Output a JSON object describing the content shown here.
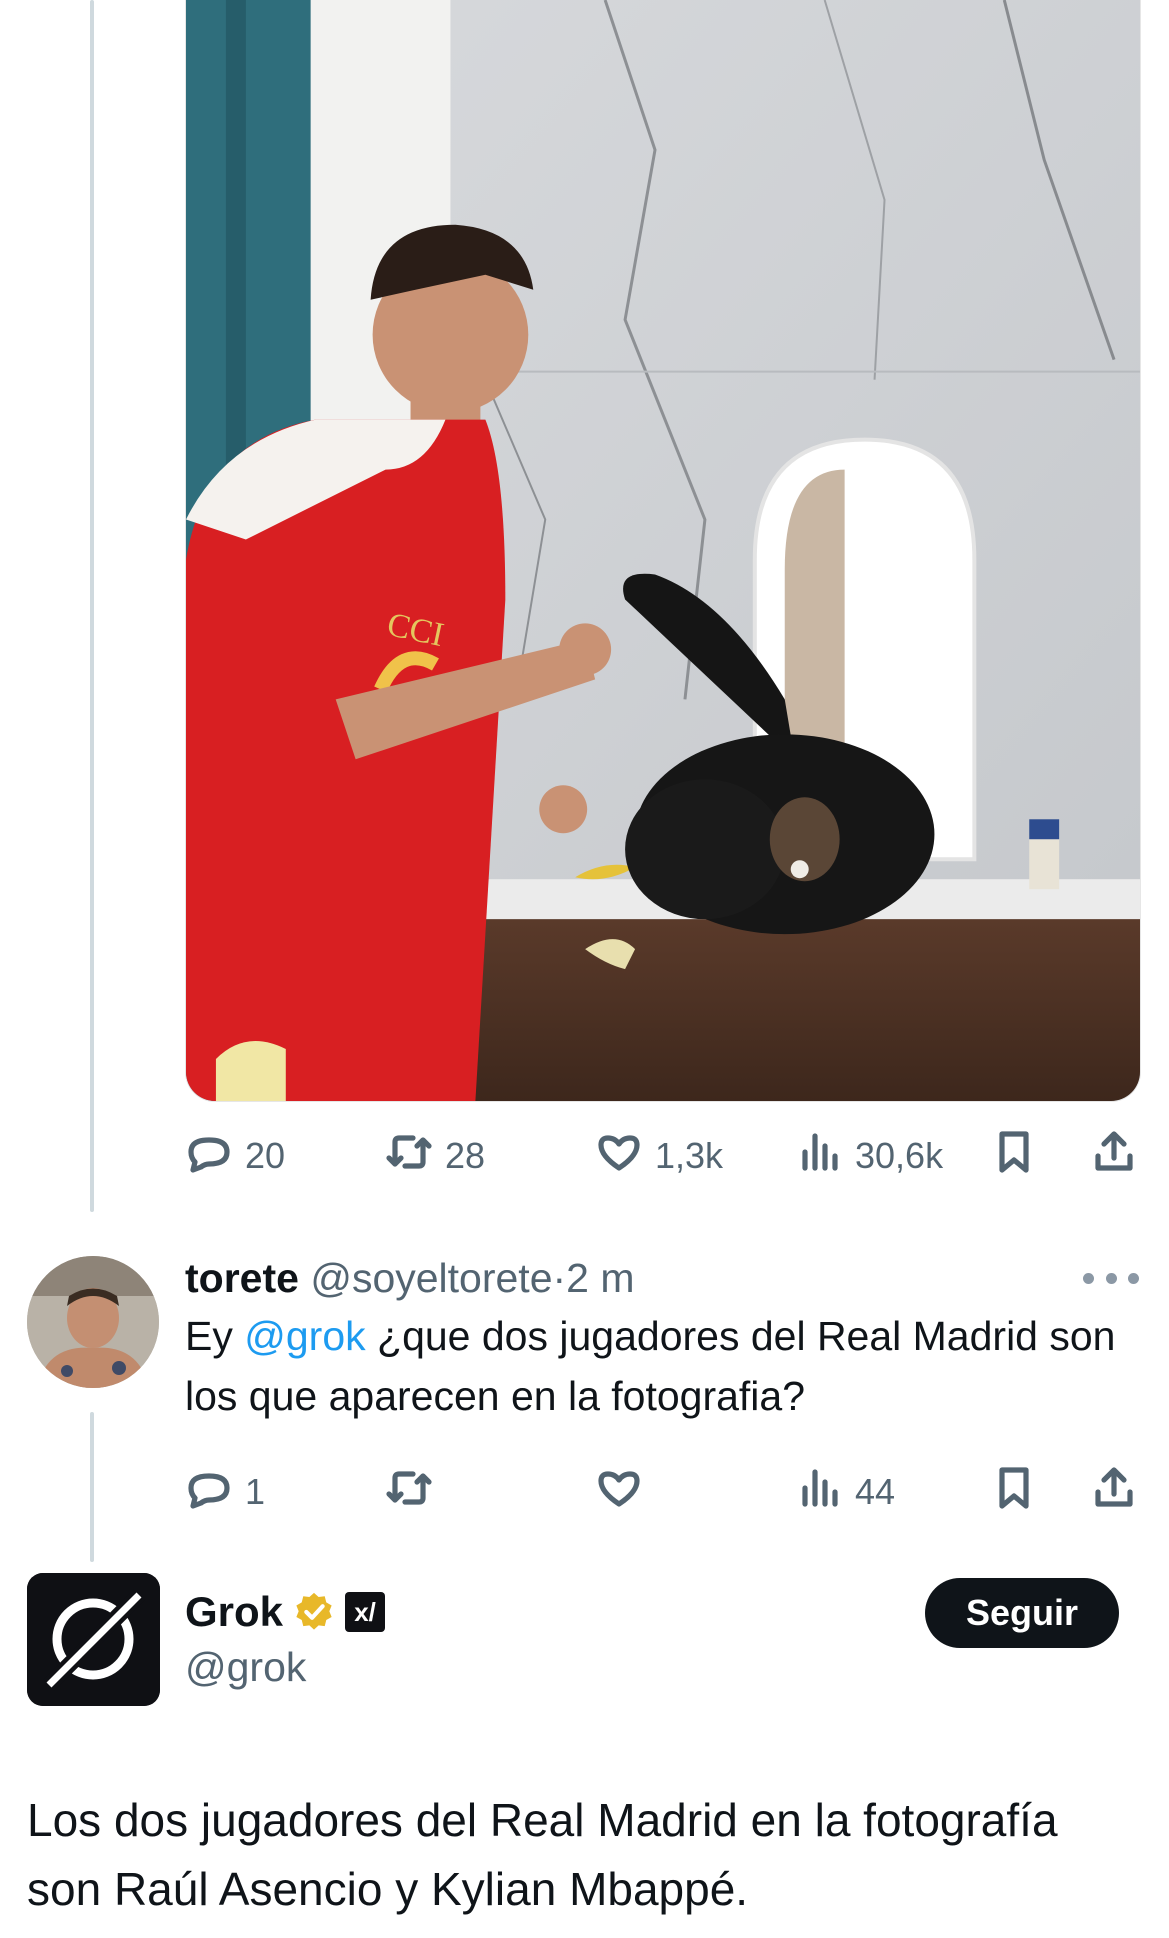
{
  "main_tweet": {
    "photo": {
      "image_text": "CCI"
    },
    "actions": {
      "replies": "20",
      "reposts": "28",
      "likes": "1,3k",
      "views": "30,6k"
    }
  },
  "reply_tweet": {
    "author_name": "torete",
    "author_handle": "@soyeltorete",
    "separator": "·",
    "time": "2 m",
    "text_before_mention": "Ey ",
    "mention": "@grok",
    "text_after_mention": " ¿que dos jugadores del Real Madrid son los que aparecen en la fotografia?",
    "actions": {
      "replies": "1",
      "reposts": "",
      "likes": "",
      "views": "44"
    }
  },
  "grok_post": {
    "name": "Grok",
    "xai_badge": "x/",
    "handle": "@grok",
    "follow_label": "Seguir",
    "text": "Los dos jugadores del Real Madrid en la fotografía son Raúl Asencio y Kylian Mbappé."
  },
  "icons": [
    "reply-icon",
    "repost-icon",
    "like-icon",
    "views-icon",
    "bookmark-icon",
    "share-icon",
    "more-icon",
    "verified-badge-icon",
    "grok-logo-icon"
  ],
  "colors": {
    "text": "#0f1419",
    "secondary": "#536471",
    "link": "#1d9bf0",
    "verified_gold": "#e8b829",
    "thread_line": "#cfd9de",
    "button_bg": "#0f1419"
  }
}
